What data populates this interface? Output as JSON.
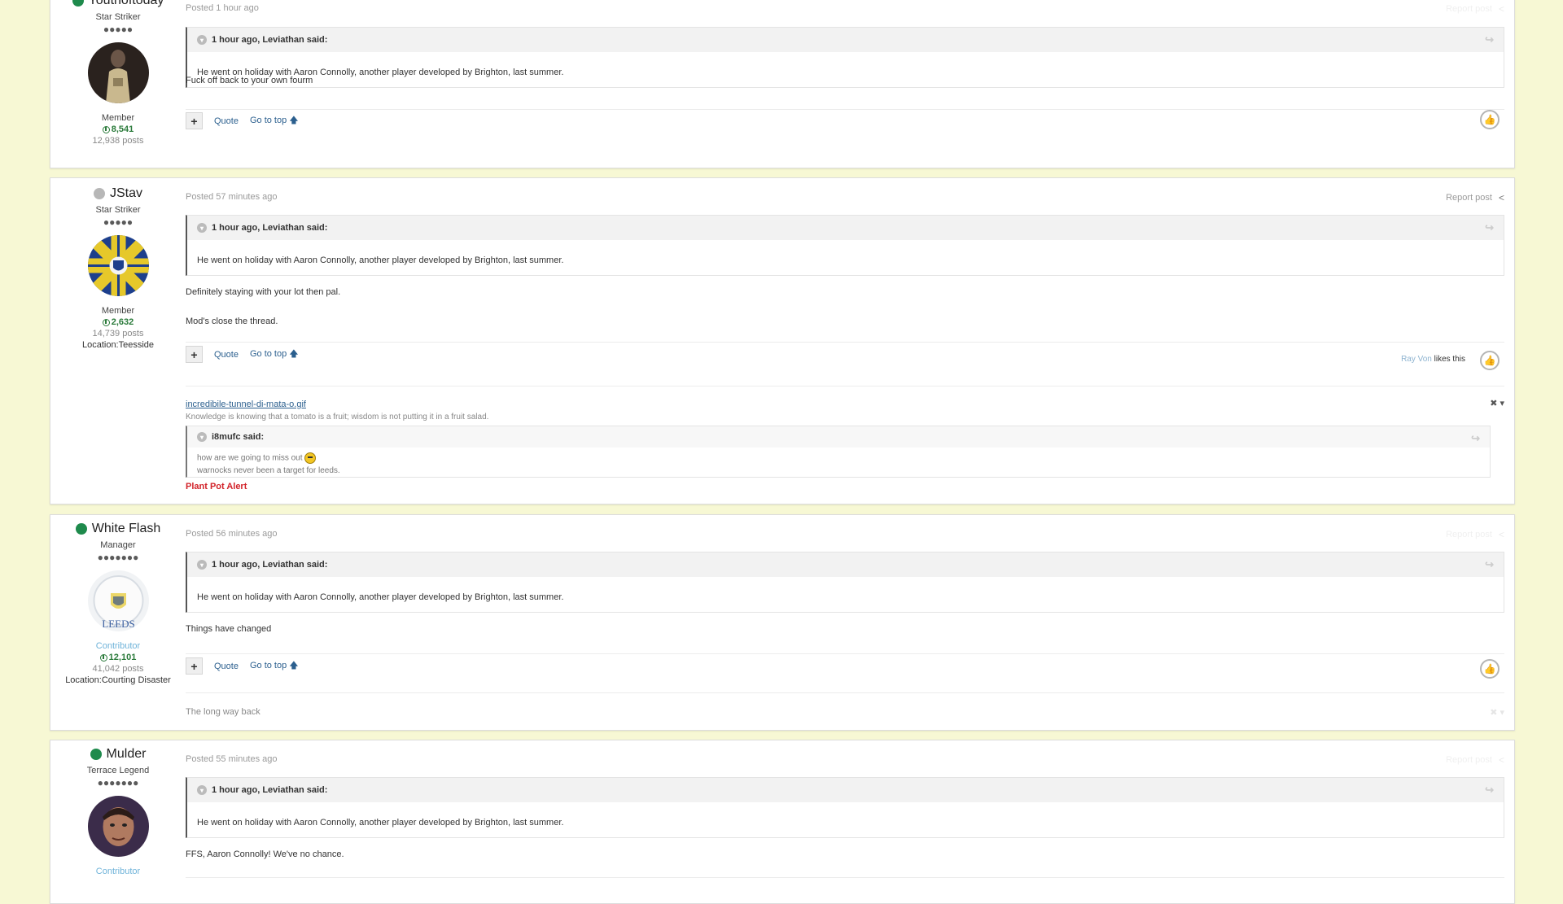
{
  "controls": {
    "quote": "Quote",
    "go_top": "Go to top",
    "plus": "+",
    "report": "Report post"
  },
  "posts": [
    {
      "author": "Youthoftoday",
      "title": "Star Striker",
      "pips": "●●●●●",
      "group": "Member",
      "rep": "8,541",
      "postcount": "12,938 posts",
      "posted": "Posted 1 hour ago",
      "quote_head": "1 hour ago, Leviathan said:",
      "quote_body": "He went on holiday with Aaron Connolly, another player developed by Brighton, last summer.",
      "text": [
        "Fuck off back to your own fourm"
      ]
    },
    {
      "author": "JStav",
      "title": "Star Striker",
      "pips": "●●●●●",
      "group": "Member",
      "rep": "2,632",
      "postcount": "14,739 posts",
      "location": "Location:Teesside",
      "posted": "Posted 57 minutes ago",
      "quote_head": "1 hour ago, Leviathan said:",
      "quote_body": "He went on holiday with Aaron Connolly, another player developed by Brighton, last summer.",
      "text": [
        "Definitely staying with your lot then pal.",
        "Mod's close the thread."
      ],
      "likes_name": "Ray Von",
      "likes_suffix": " likes this",
      "sig_image": "incredibile-tunnel-di-mata-o.gif",
      "sig_text": "Knowledge is knowing that a tomato is a fruit; wisdom is not putting it in a fruit salad.",
      "sig_quote_head": "i8mufc said:",
      "sig_quote_lines": [
        "how are we going to miss out",
        "warnocks never been a target for leeds."
      ],
      "sig_red": "Plant Pot Alert",
      "close": "✖ ▾"
    },
    {
      "author": "White Flash",
      "title": "Manager",
      "pips": "●●●●●●●",
      "group": "Contributor",
      "rep": "12,101",
      "postcount": "41,042 posts",
      "location": "Location:Courting Disaster",
      "posted": "Posted 56 minutes ago",
      "quote_head": "1 hour ago, Leviathan said:",
      "quote_body": "He went on holiday with Aaron Connolly, another player developed by Brighton, last summer.",
      "text": [
        "Things have changed"
      ],
      "sig_text": "The long way back"
    },
    {
      "author": "Mulder",
      "title": "Terrace Legend",
      "pips": "●●●●●●●",
      "group": "Contributor",
      "posted": "Posted 55 minutes ago",
      "quote_head": "1 hour ago, Leviathan said:",
      "quote_body": "He went on holiday with Aaron Connolly, another player developed by Brighton, last summer.",
      "text": [
        "FFS, Aaron Connolly! We've no chance."
      ]
    }
  ]
}
